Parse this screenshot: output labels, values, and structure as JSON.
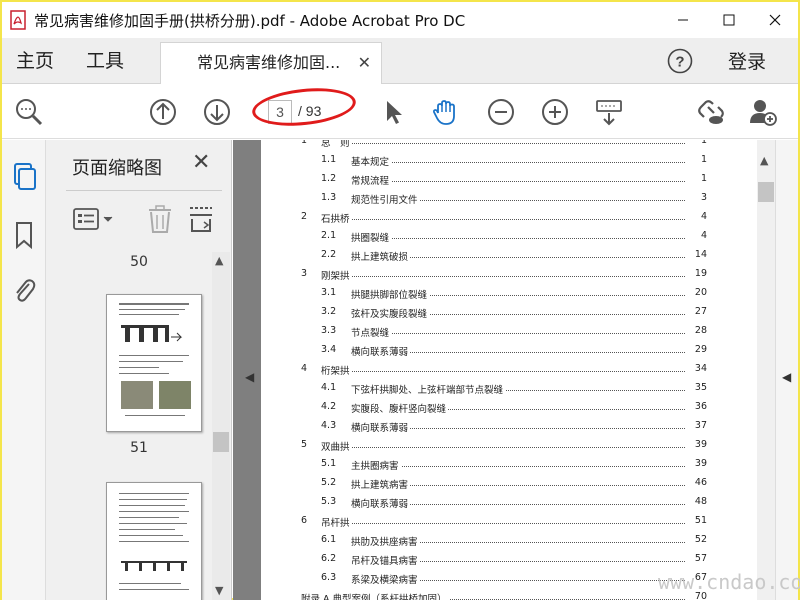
{
  "window": {
    "title": "常见病害维修加固手册(拱桥分册).pdf - Adobe Acrobat Pro DC",
    "minimize_icon": "minimize-icon",
    "maximize_icon": "maximize-icon",
    "close_icon": "close-icon"
  },
  "tabs": {
    "home": "主页",
    "tools": "工具",
    "document": "常见病害维修加固...",
    "help_icon": "help-icon",
    "login": "登录"
  },
  "toolbar": {
    "current_page": "3",
    "total_pages": "/ 93",
    "highlight_color": "#e01b1b"
  },
  "thumbnails_panel": {
    "title": "页面缩略图",
    "pages": [
      "50",
      "51"
    ]
  },
  "toc": [
    {
      "num": "1",
      "title": "总　则",
      "page": "1",
      "level": 1
    },
    {
      "num": "1.1",
      "title": "基本规定",
      "page": "1",
      "level": 2
    },
    {
      "num": "1.2",
      "title": "常规流程",
      "page": "1",
      "level": 2
    },
    {
      "num": "1.3",
      "title": "规范性引用文件",
      "page": "3",
      "level": 2
    },
    {
      "num": "2",
      "title": "石拱桥",
      "page": "4",
      "level": 1
    },
    {
      "num": "2.1",
      "title": "拱圈裂缝",
      "page": "4",
      "level": 2
    },
    {
      "num": "2.2",
      "title": "拱上建筑破损",
      "page": "14",
      "level": 2
    },
    {
      "num": "3",
      "title": "刚架拱",
      "page": "19",
      "level": 1
    },
    {
      "num": "3.1",
      "title": "拱腿拱脚部位裂缝",
      "page": "20",
      "level": 2
    },
    {
      "num": "3.2",
      "title": "弦杆及实腹段裂缝",
      "page": "27",
      "level": 2
    },
    {
      "num": "3.3",
      "title": "节点裂缝",
      "page": "28",
      "level": 2
    },
    {
      "num": "3.4",
      "title": "横向联系薄弱",
      "page": "29",
      "level": 2
    },
    {
      "num": "4",
      "title": "桁架拱",
      "page": "34",
      "level": 1
    },
    {
      "num": "4.1",
      "title": "下弦杆拱脚处、上弦杆端部节点裂缝",
      "page": "35",
      "level": 2
    },
    {
      "num": "4.2",
      "title": "实腹段、腹杆竖向裂缝",
      "page": "36",
      "level": 2
    },
    {
      "num": "4.3",
      "title": "横向联系薄弱",
      "page": "37",
      "level": 2
    },
    {
      "num": "5",
      "title": "双曲拱",
      "page": "39",
      "level": 1
    },
    {
      "num": "5.1",
      "title": "主拱圈病害",
      "page": "39",
      "level": 2
    },
    {
      "num": "5.2",
      "title": "拱上建筑病害",
      "page": "46",
      "level": 2
    },
    {
      "num": "5.3",
      "title": "横向联系薄弱",
      "page": "48",
      "level": 2
    },
    {
      "num": "6",
      "title": "吊杆拱",
      "page": "51",
      "level": 1
    },
    {
      "num": "6.1",
      "title": "拱肋及拱座病害",
      "page": "52",
      "level": 2
    },
    {
      "num": "6.2",
      "title": "吊杆及锚具病害",
      "page": "57",
      "level": 2
    },
    {
      "num": "6.3",
      "title": "系梁及横梁病害",
      "page": "67",
      "level": 2
    },
    {
      "num": "",
      "title": "附录 A 典型案例（系杆拱桥加固）",
      "page": "70",
      "level": 1
    }
  ],
  "watermark": "www.cndao.com"
}
